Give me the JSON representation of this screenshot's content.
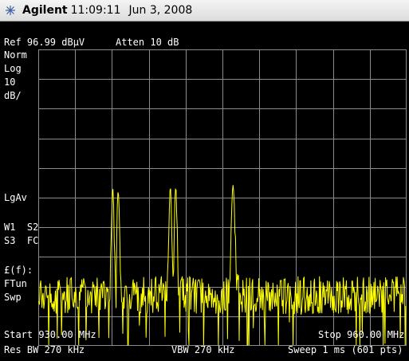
{
  "titlebar": {
    "brand": "Agilent",
    "time": "11:09:11",
    "date": "Jun 3, 2008",
    "logo_icon": "agilent-spark-icon"
  },
  "header": {
    "ref": "Ref 96.99 dBµV",
    "atten": "Atten 10 dB"
  },
  "left_annotations": {
    "norm": "Norm",
    "log": "Log",
    "scale_value": "10",
    "scale_unit": "dB/",
    "lgav": "LgAv",
    "w1s2": "W1  S2",
    "s3fc": "S3  FC",
    "ff": "£(f):",
    "ftun": "FTun",
    "swp": "Swp"
  },
  "footer": {
    "start": "Start 930.00 MHz",
    "stop": "Stop 960.00 MHz",
    "res_bw": "Res BW 270 kHz",
    "vbw": "VBW 270 kHz",
    "sweep": "Sweep 1 ms (601 pts)"
  },
  "colors": {
    "background": "#000000",
    "grid": "#8c8c8c",
    "trace": "#ffff00",
    "text": "#ffffff"
  },
  "trace": {
    "points": 601,
    "noise_floor_div": 8.3,
    "peaks": [
      {
        "freq_mhz": 936.3,
        "level_div": 4.7,
        "shape": "double"
      },
      {
        "freq_mhz": 941.0,
        "level_div": 4.6,
        "shape": "double"
      },
      {
        "freq_mhz": 945.9,
        "level_div": 4.6,
        "shape": "single"
      }
    ]
  }
}
